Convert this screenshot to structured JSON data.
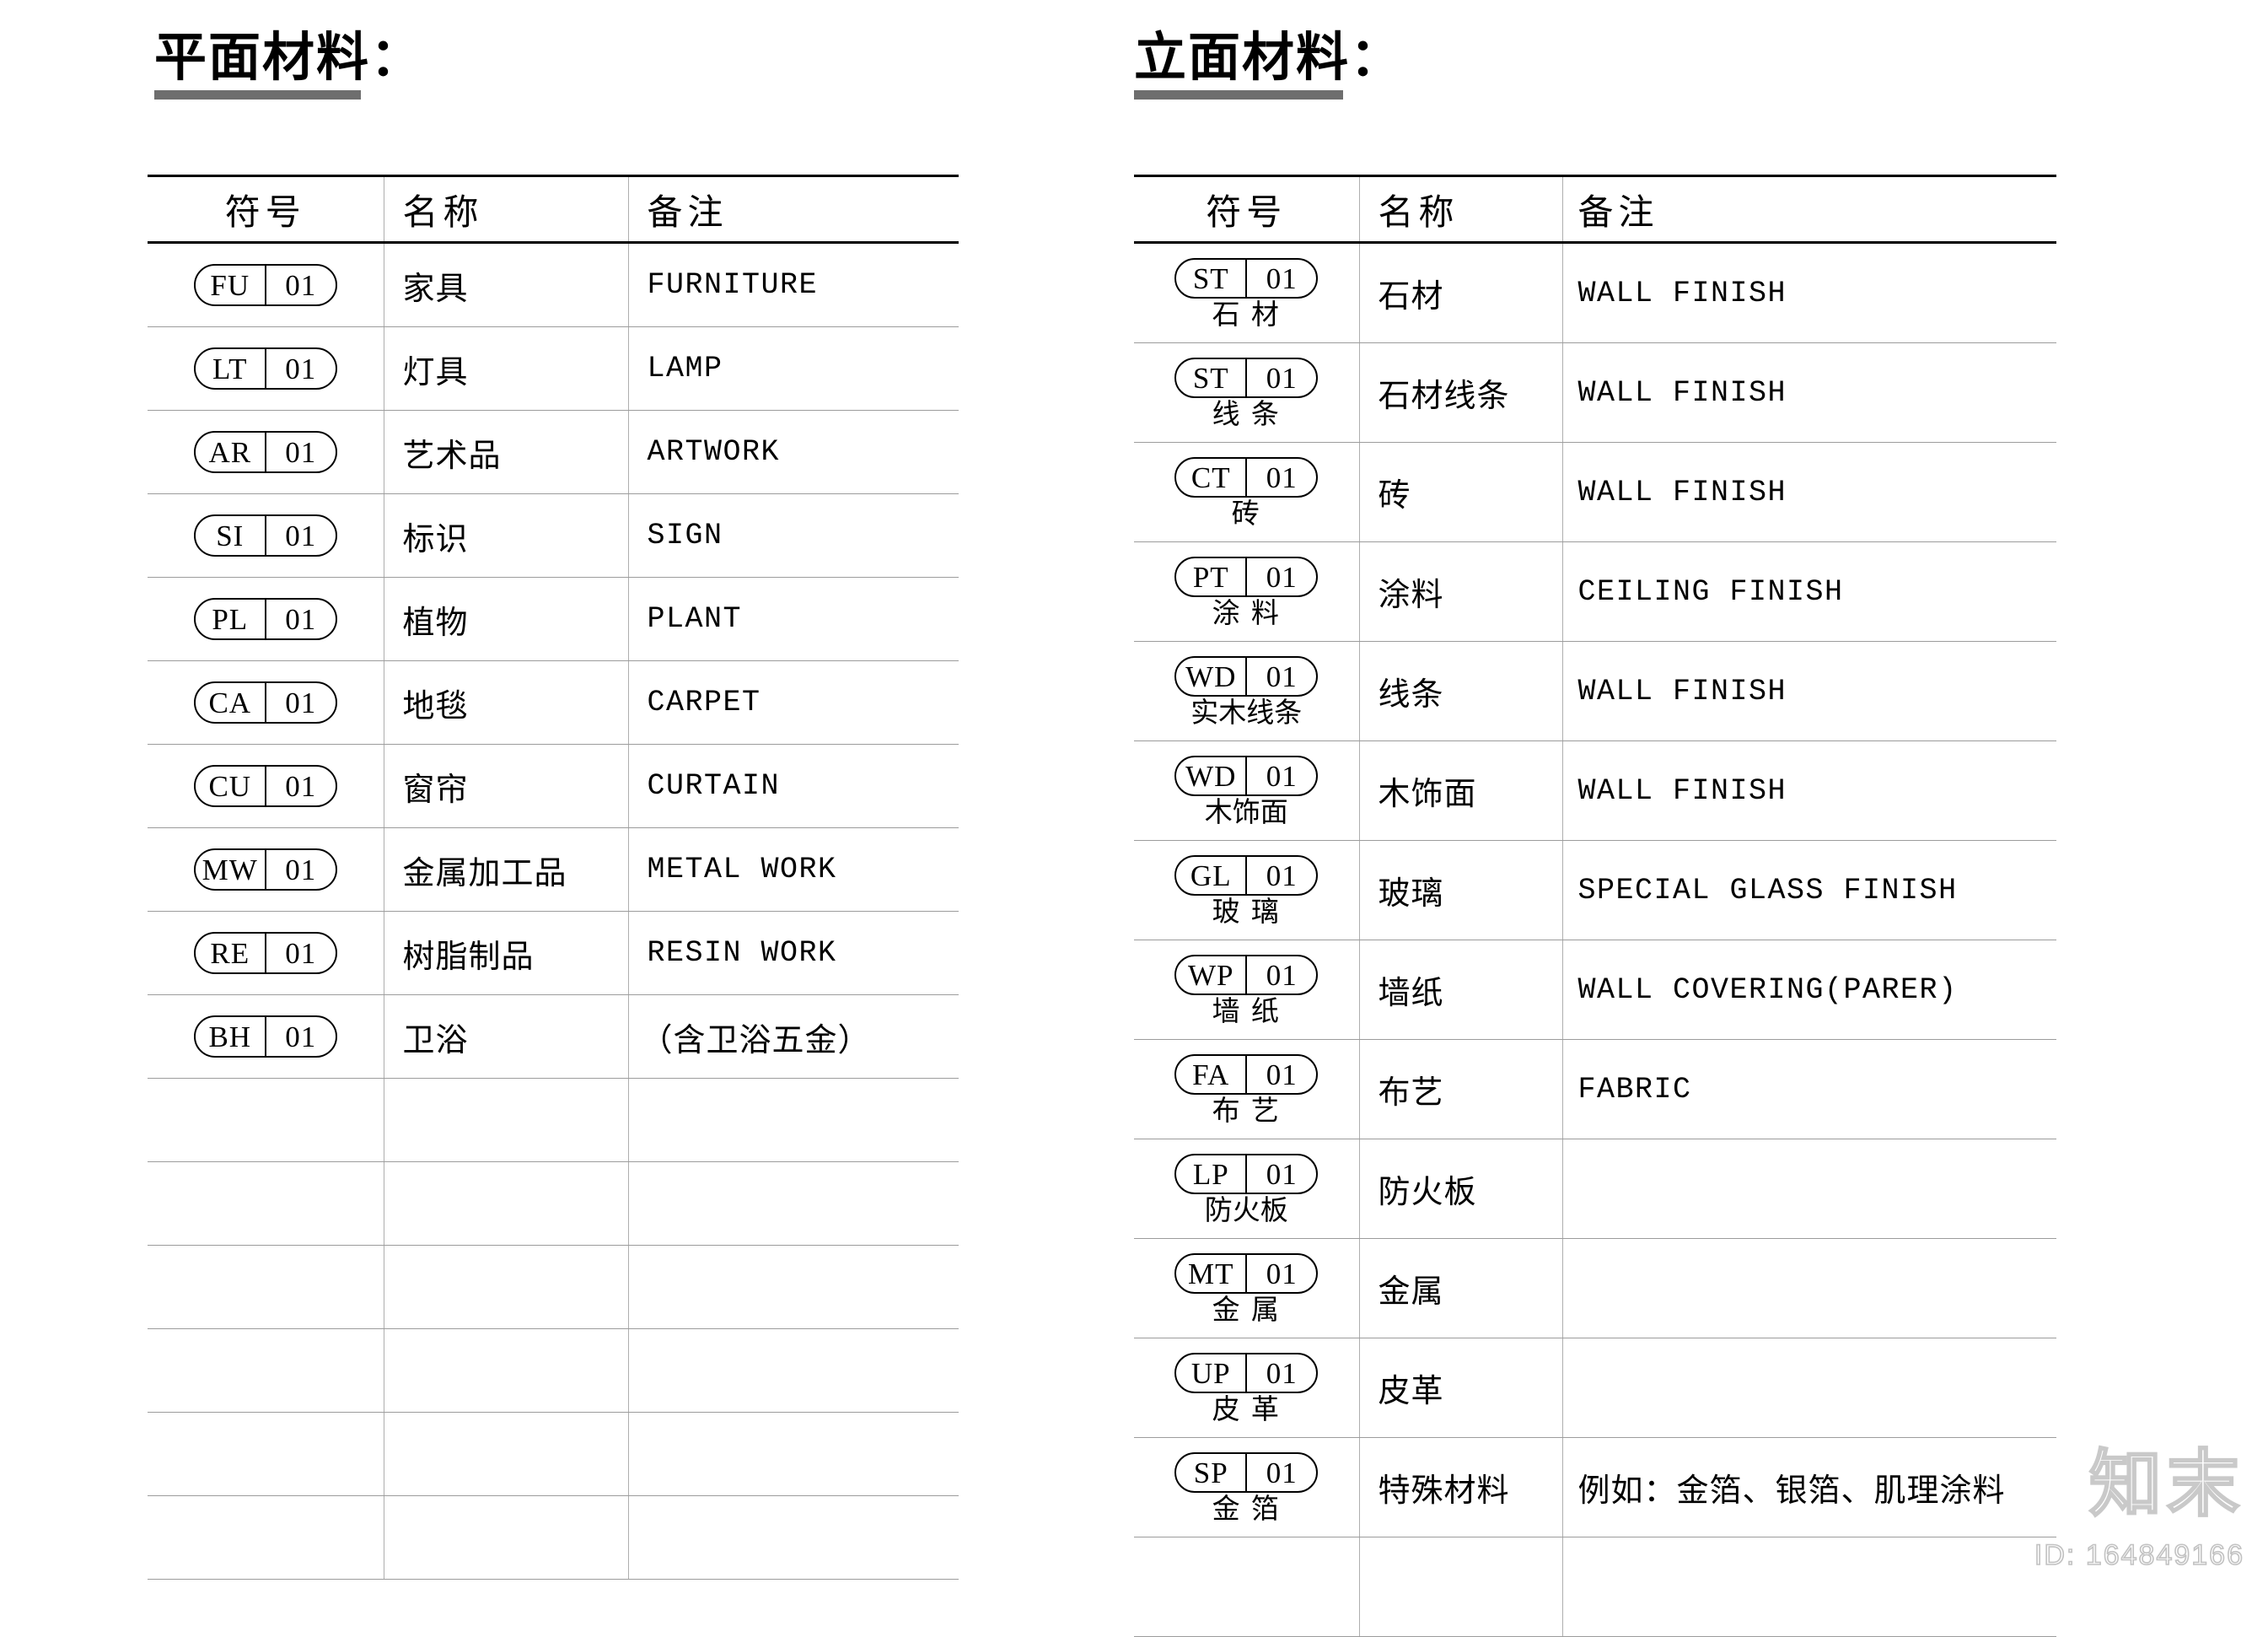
{
  "document": {
    "background_color": "#ffffff",
    "rule_color": "#6e6e6e",
    "grid_color": "#9c9c9c",
    "header_rule_color": "#000000"
  },
  "columns": {
    "symbol": "符号",
    "name": "名称",
    "note": "备注"
  },
  "plan": {
    "title": "平面材料：",
    "rows": [
      {
        "code": "FU",
        "num": "01",
        "name": "家具",
        "note": "FURNITURE",
        "note_cjk": false
      },
      {
        "code": "LT",
        "num": "01",
        "name": "灯具",
        "note": "LAMP",
        "note_cjk": false
      },
      {
        "code": "AR",
        "num": "01",
        "name": "艺术品",
        "note": "ARTWORK",
        "note_cjk": false
      },
      {
        "code": "SI",
        "num": "01",
        "name": "标识",
        "note": "SIGN",
        "note_cjk": false
      },
      {
        "code": "PL",
        "num": "01",
        "name": "植物",
        "note": "PLANT",
        "note_cjk": false
      },
      {
        "code": "CA",
        "num": "01",
        "name": "地毯",
        "note": "CARPET",
        "note_cjk": false
      },
      {
        "code": "CU",
        "num": "01",
        "name": "窗帘",
        "note": "CURTAIN",
        "note_cjk": false
      },
      {
        "code": "MW",
        "num": "01",
        "name": "金属加工品",
        "note": "METAL WORK",
        "note_cjk": false
      },
      {
        "code": "RE",
        "num": "01",
        "name": "树脂制品",
        "note": "RESIN WORK",
        "note_cjk": false
      },
      {
        "code": "BH",
        "num": "01",
        "name": "卫浴",
        "note": "（含卫浴五金）",
        "note_cjk": true
      }
    ],
    "empty_row_count": 6
  },
  "elevation": {
    "title": "立面材料：",
    "rows": [
      {
        "code": "ST",
        "num": "01",
        "sublabel": "石 材",
        "name": "石材",
        "note": "WALL FINISH"
      },
      {
        "code": "ST",
        "num": "01",
        "sublabel": "线 条",
        "name": "石材线条",
        "note": "WALL FINISH"
      },
      {
        "code": "CT",
        "num": "01",
        "sublabel": "砖",
        "name": "砖",
        "note": "WALL FINISH"
      },
      {
        "code": "PT",
        "num": "01",
        "sublabel": "涂 料",
        "name": "涂料",
        "note": "CEILING FINISH"
      },
      {
        "code": "WD",
        "num": "01",
        "sublabel": "实木线条",
        "name": "线条",
        "note": "WALL FINISH"
      },
      {
        "code": "WD",
        "num": "01",
        "sublabel": "木饰面",
        "name": "木饰面",
        "note": "WALL FINISH"
      },
      {
        "code": "GL",
        "num": "01",
        "sublabel": "玻 璃",
        "name": "玻璃",
        "note": "SPECIAL GLASS FINISH"
      },
      {
        "code": "WP",
        "num": "01",
        "sublabel": "墙 纸",
        "name": "墙纸",
        "note": "WALL COVERING(PARER)"
      },
      {
        "code": "FA",
        "num": "01",
        "sublabel": "布 艺",
        "name": "布艺",
        "note": "FABRIC"
      },
      {
        "code": "LP",
        "num": "01",
        "sublabel": "防火板",
        "name": "防火板",
        "note": ""
      },
      {
        "code": "MT",
        "num": "01",
        "sublabel": "金 属",
        "name": "金属",
        "note": ""
      },
      {
        "code": "UP",
        "num": "01",
        "sublabel": "皮 革",
        "name": "皮革",
        "note": ""
      },
      {
        "code": "SP",
        "num": "01",
        "sublabel": "金 箔",
        "name": "特殊材料",
        "note": "例如：金箔、银箔、肌理涂料",
        "note_cjk": true
      }
    ],
    "empty_row_count": 1
  },
  "watermark": {
    "text": "知末",
    "id": "ID: 164849166"
  }
}
